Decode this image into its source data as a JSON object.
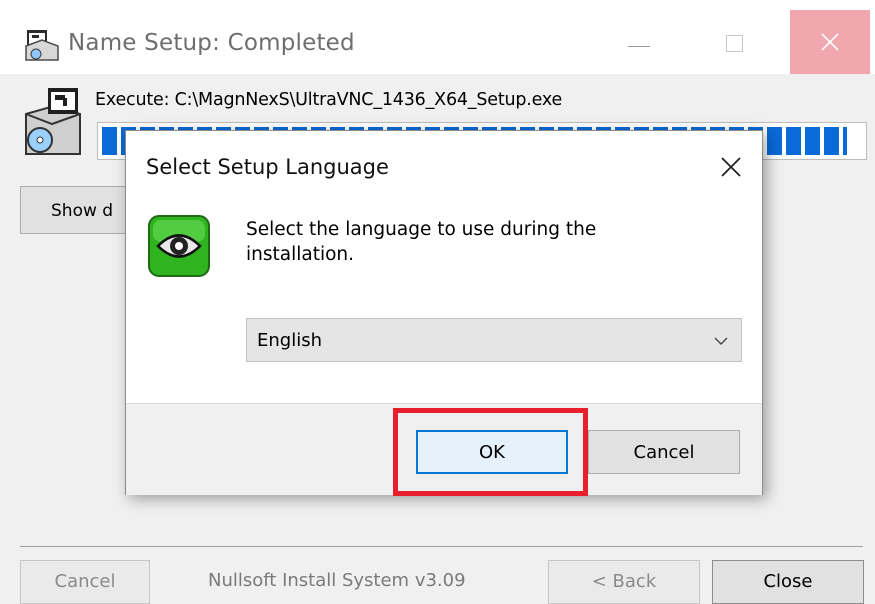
{
  "window": {
    "title": "Name Setup: Completed",
    "execute_text": "Execute: C:\\MagnNexS\\UltraVNC_1436_X64_Setup.exe",
    "progress_percent": 98,
    "show_details_label": "Show d",
    "branding": "Nullsoft Install System v3.09",
    "buttons": {
      "cancel": "Cancel",
      "back": "< Back",
      "close": "Close"
    }
  },
  "dialog": {
    "title": "Select Setup Language",
    "message": "Select the language to use during the installation.",
    "language": {
      "selected": "English"
    },
    "ok_label": "OK",
    "cancel_label": "Cancel"
  },
  "colors": {
    "accent": "#0078d7",
    "progress": "#0a6ad8",
    "highlight": "#e8202e",
    "close_hover": "#f1a7ae"
  },
  "icons": {
    "app": "installer-package-icon",
    "dialog": "ultravnc-eye-icon",
    "dropdown": "chevron-down-icon",
    "close": "close-icon"
  }
}
